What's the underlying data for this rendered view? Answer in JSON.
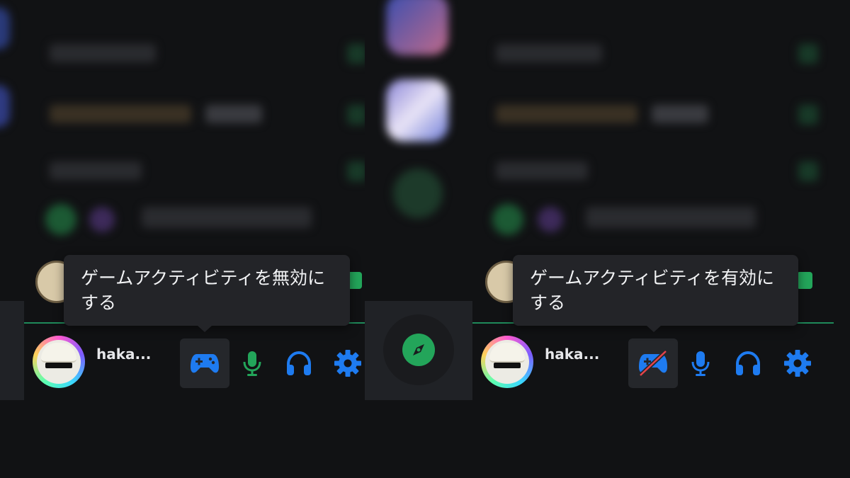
{
  "left": {
    "username": "haka...",
    "tooltip_text": "ゲームアクティビティを無効にする",
    "game_activity_state": "enabled"
  },
  "right": {
    "username": "haka...",
    "tooltip_text": "ゲームアクティビティを有効にする",
    "game_activity_state": "disabled"
  },
  "icons": {
    "game_activity": "gamepad-icon",
    "game_activity_off": "gamepad-off-icon",
    "microphone": "microphone-icon",
    "headphones": "headphones-icon",
    "settings": "gear-icon",
    "discover": "compass-icon"
  },
  "colors": {
    "background": "#111214",
    "accent_blue": "#1e7bf0",
    "mic_green": "#23a55a",
    "tooltip_bg": "#232428",
    "discover_green": "#23a55a",
    "mute_red": "#e5434a"
  }
}
